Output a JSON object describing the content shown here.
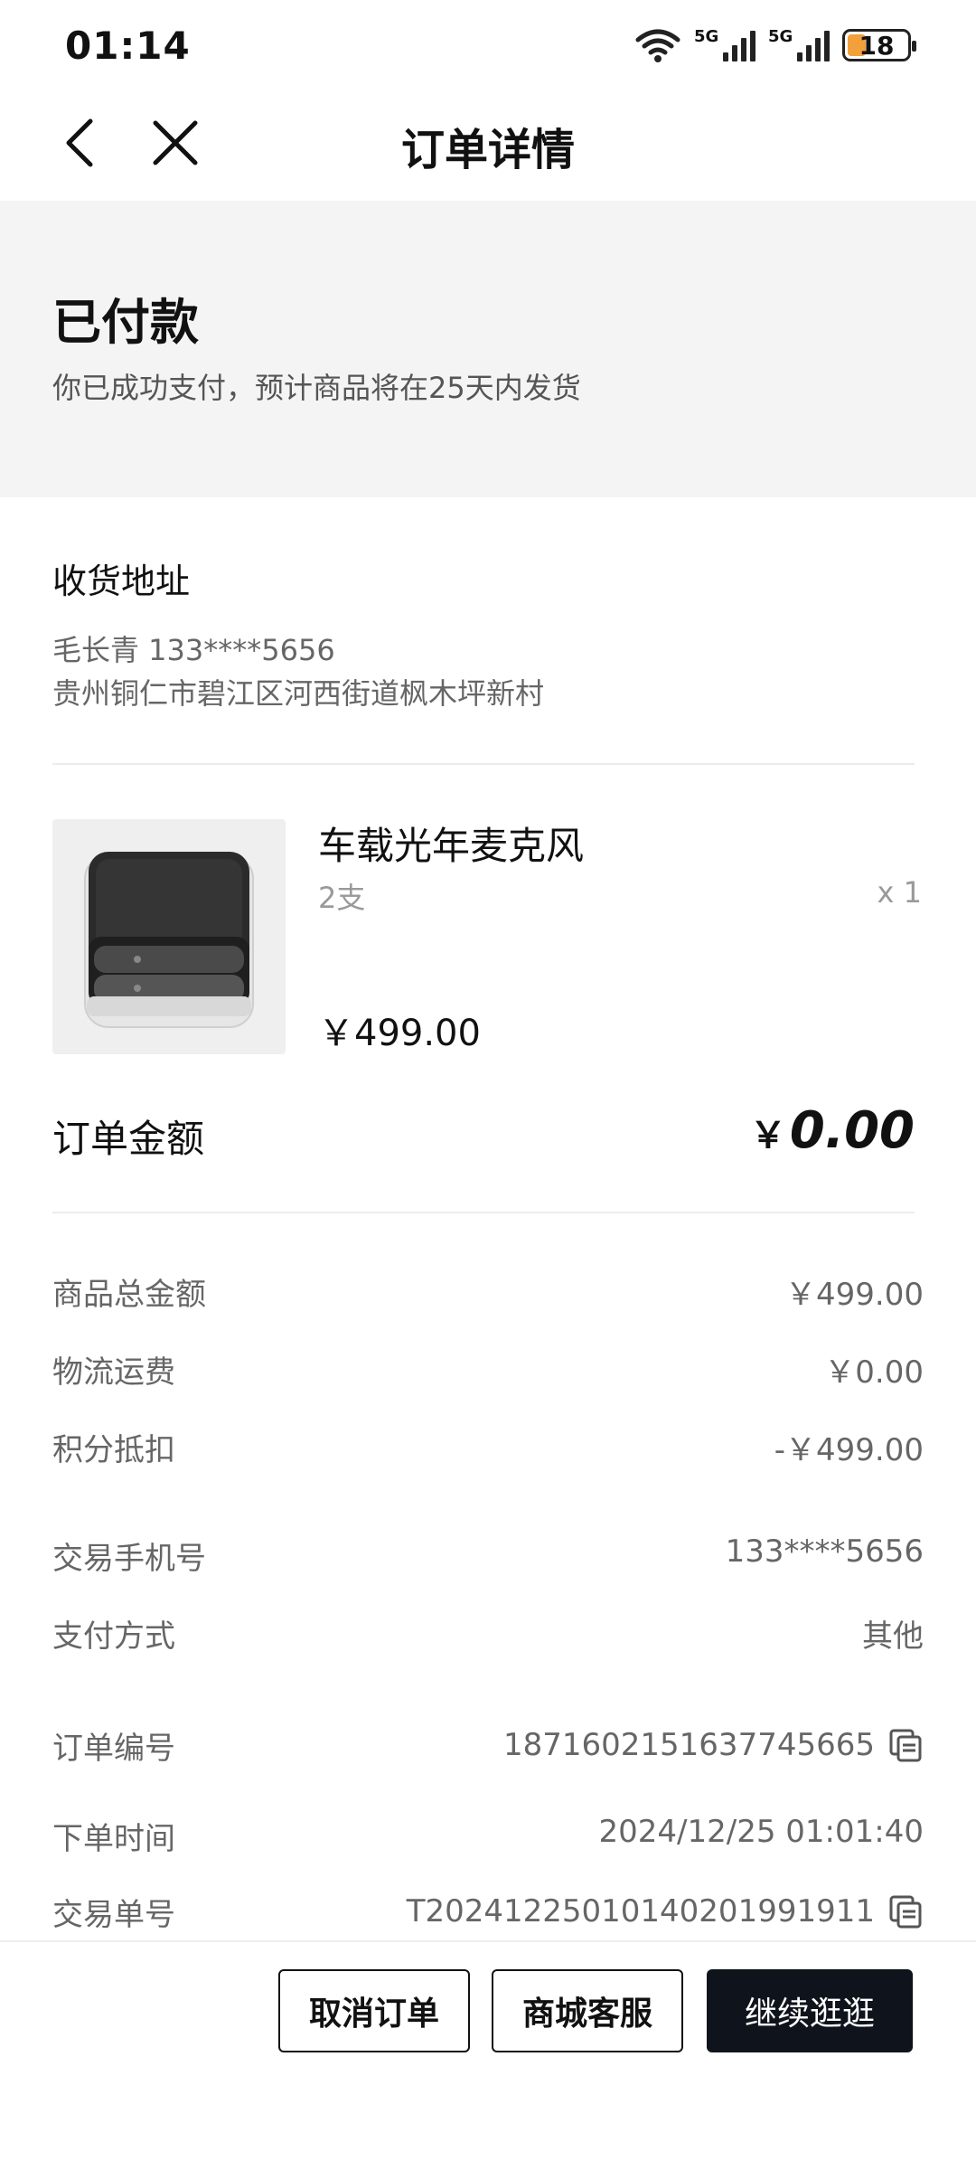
{
  "status_bar": {
    "time": "01:14",
    "network_1": "5G",
    "network_2": "5G",
    "battery": "18",
    "icons": [
      "wifi-icon",
      "signal-icon",
      "signal-icon",
      "battery-icon"
    ]
  },
  "nav": {
    "title": "订单详情",
    "icons": [
      "back-arrow-icon",
      "close-icon"
    ]
  },
  "order_status": {
    "title": "已付款",
    "description": "你已成功支付，预计商品将在25天内发货"
  },
  "address": {
    "title": "收货地址",
    "name_phone": "毛长青  133****5656",
    "detail": "贵州铜仁市碧江区河西街道枫木坪新村"
  },
  "product": {
    "name": "车载光年麦克风",
    "spec": "2支",
    "quantity": "x 1",
    "price": "￥499.00"
  },
  "order_amount": {
    "label": "订单金额",
    "currency": "￥",
    "value": "0.00"
  },
  "details": [
    {
      "label": "商品总金额",
      "value": "￥499.00"
    },
    {
      "label": "物流运费",
      "value": "￥0.00"
    },
    {
      "label": "积分抵扣",
      "value": "-￥499.00"
    },
    {
      "label": "交易手机号",
      "value": "133****5656"
    },
    {
      "label": "支付方式",
      "value": "其他"
    },
    {
      "label": "订单编号",
      "value": "1871602151637745665",
      "icon": "copy-icon"
    },
    {
      "label": "下单时间",
      "value": "2024/12/25 01:01:40"
    },
    {
      "label": "交易单号",
      "value": "T20241225010140201991911",
      "icon": "copy-icon"
    }
  ],
  "actions": {
    "cancel": "取消订单",
    "service": "商城客服",
    "continue": "继续逛逛"
  }
}
